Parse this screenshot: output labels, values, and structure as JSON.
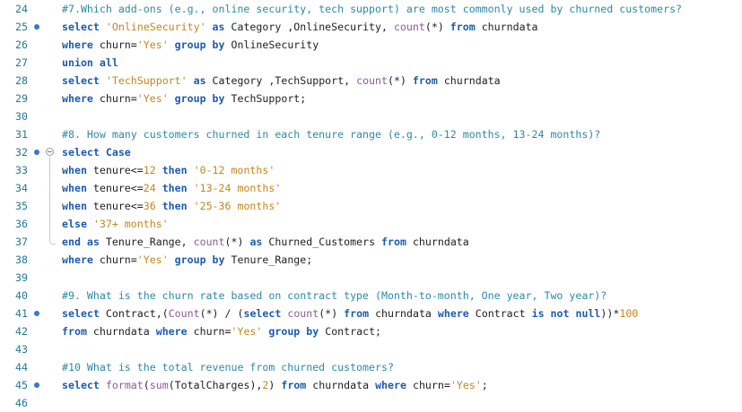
{
  "lines": [
    {
      "n": "24",
      "bp": false,
      "tokens": [
        [
          "cm",
          "#7.Which add-ons (e.g., online security, tech support) are most commonly used by churned customers?"
        ]
      ]
    },
    {
      "n": "25",
      "bp": true,
      "tokens": [
        [
          "kw",
          "select "
        ],
        [
          "str",
          "'OnlineSecurity'"
        ],
        [
          "kw",
          " as "
        ],
        [
          "pl",
          "Category ,OnlineSecurity, "
        ],
        [
          "fn",
          "count"
        ],
        [
          "pl",
          "(*) "
        ],
        [
          "kw",
          "from "
        ],
        [
          "pl",
          "churndata"
        ]
      ]
    },
    {
      "n": "26",
      "bp": false,
      "tokens": [
        [
          "kw",
          "where "
        ],
        [
          "pl",
          "churn="
        ],
        [
          "str",
          "'Yes'"
        ],
        [
          "kw",
          " group by "
        ],
        [
          "pl",
          "OnlineSecurity"
        ]
      ]
    },
    {
      "n": "27",
      "bp": false,
      "tokens": [
        [
          "kw",
          "union all"
        ]
      ]
    },
    {
      "n": "28",
      "bp": false,
      "tokens": [
        [
          "kw",
          "select "
        ],
        [
          "str",
          "'TechSupport'"
        ],
        [
          "kw",
          " as "
        ],
        [
          "pl",
          "Category ,TechSupport, "
        ],
        [
          "fn",
          "count"
        ],
        [
          "pl",
          "(*) "
        ],
        [
          "kw",
          "from "
        ],
        [
          "pl",
          "churndata"
        ]
      ]
    },
    {
      "n": "29",
      "bp": false,
      "tokens": [
        [
          "kw",
          "where "
        ],
        [
          "pl",
          "churn="
        ],
        [
          "str",
          "'Yes'"
        ],
        [
          "kw",
          " group by "
        ],
        [
          "pl",
          "TechSupport;"
        ]
      ]
    },
    {
      "n": "30",
      "bp": false,
      "tokens": []
    },
    {
      "n": "31",
      "bp": false,
      "tokens": [
        [
          "cm",
          "#8. How many customers churned in each tenure range (e.g., 0-12 months, 13-24 months)?"
        ]
      ]
    },
    {
      "n": "32",
      "bp": true,
      "fold": "start",
      "tokens": [
        [
          "kw",
          "select Case"
        ]
      ]
    },
    {
      "n": "33",
      "bp": false,
      "tokens": [
        [
          "kw",
          "when "
        ],
        [
          "pl",
          "tenure<="
        ],
        [
          "num",
          "12"
        ],
        [
          "kw",
          " then "
        ],
        [
          "str",
          "'0-12 months'"
        ]
      ]
    },
    {
      "n": "34",
      "bp": false,
      "tokens": [
        [
          "kw",
          "when "
        ],
        [
          "pl",
          "tenure<="
        ],
        [
          "num",
          "24"
        ],
        [
          "kw",
          " then "
        ],
        [
          "str",
          "'13-24 months'"
        ]
      ]
    },
    {
      "n": "35",
      "bp": false,
      "tokens": [
        [
          "kw",
          "when "
        ],
        [
          "pl",
          "tenure<="
        ],
        [
          "num",
          "36"
        ],
        [
          "kw",
          " then "
        ],
        [
          "str",
          "'25-36 months'"
        ]
      ]
    },
    {
      "n": "36",
      "bp": false,
      "tokens": [
        [
          "kw",
          "else "
        ],
        [
          "str",
          "'37+ months'"
        ]
      ]
    },
    {
      "n": "37",
      "bp": false,
      "fold": "end",
      "tokens": [
        [
          "kw",
          "end as "
        ],
        [
          "pl",
          "Tenure_Range, "
        ],
        [
          "fn",
          "count"
        ],
        [
          "pl",
          "(*) "
        ],
        [
          "kw",
          "as "
        ],
        [
          "pl",
          "Churned_Customers "
        ],
        [
          "kw",
          "from "
        ],
        [
          "pl",
          "churndata"
        ]
      ]
    },
    {
      "n": "38",
      "bp": false,
      "tokens": [
        [
          "kw",
          "where "
        ],
        [
          "pl",
          "churn="
        ],
        [
          "str",
          "'Yes'"
        ],
        [
          "kw",
          " group by "
        ],
        [
          "pl",
          "Tenure_Range;"
        ]
      ]
    },
    {
      "n": "39",
      "bp": false,
      "tokens": []
    },
    {
      "n": "40",
      "bp": false,
      "tokens": [
        [
          "cm",
          "#9. What is the churn rate based on contract type (Month-to-month, One year, Two year)?"
        ]
      ]
    },
    {
      "n": "41",
      "bp": true,
      "tokens": [
        [
          "kw",
          "select "
        ],
        [
          "pl",
          "Contract,("
        ],
        [
          "fn",
          "Count"
        ],
        [
          "pl",
          "(*) / ("
        ],
        [
          "kw",
          "select "
        ],
        [
          "fn",
          "count"
        ],
        [
          "pl",
          "(*) "
        ],
        [
          "kw",
          "from "
        ],
        [
          "pl",
          "churndata "
        ],
        [
          "kw",
          "where "
        ],
        [
          "pl",
          "Contract "
        ],
        [
          "kw",
          "is not null"
        ],
        [
          "pl",
          "))*"
        ],
        [
          "num",
          "100"
        ]
      ]
    },
    {
      "n": "42",
      "bp": false,
      "tokens": [
        [
          "kw",
          "from "
        ],
        [
          "pl",
          "churndata "
        ],
        [
          "kw",
          "where "
        ],
        [
          "pl",
          "churn="
        ],
        [
          "str",
          "'Yes'"
        ],
        [
          "kw",
          " group by "
        ],
        [
          "pl",
          "Contract;"
        ]
      ]
    },
    {
      "n": "43",
      "bp": false,
      "tokens": []
    },
    {
      "n": "44",
      "bp": false,
      "tokens": [
        [
          "cm",
          "#10 What is the total revenue from churned customers?"
        ]
      ]
    },
    {
      "n": "45",
      "bp": true,
      "tokens": [
        [
          "kw",
          "select "
        ],
        [
          "fn",
          "format"
        ],
        [
          "pl",
          "("
        ],
        [
          "fn",
          "sum"
        ],
        [
          "pl",
          "(TotalCharges),"
        ],
        [
          "num",
          "2"
        ],
        [
          "pl",
          ") "
        ],
        [
          "kw",
          "from "
        ],
        [
          "pl",
          "churndata "
        ],
        [
          "kw",
          "where "
        ],
        [
          "pl",
          "churn="
        ],
        [
          "str",
          "'Yes'"
        ],
        [
          "pl",
          ";"
        ]
      ]
    },
    {
      "n": "46",
      "bp": false,
      "tokens": []
    }
  ]
}
